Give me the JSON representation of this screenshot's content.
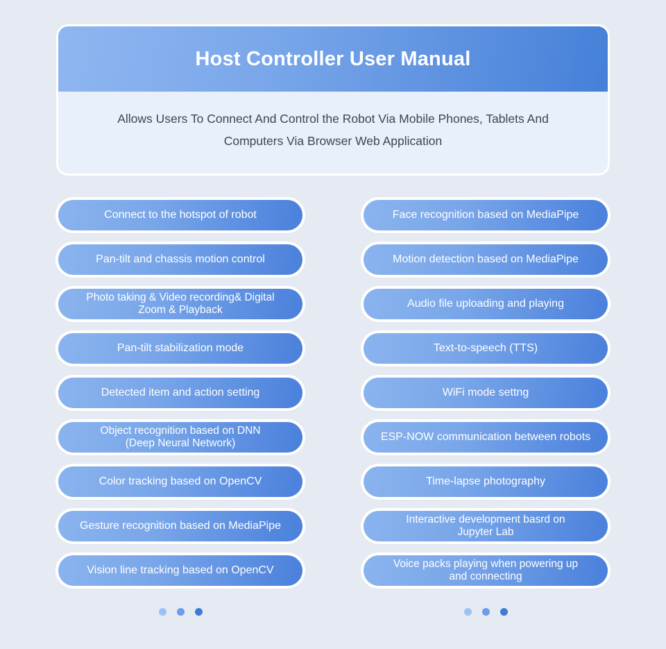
{
  "background_color": "#e6eaf2",
  "header": {
    "title": "Host Controller User Manual",
    "subtitle": "Allows Users To Connect And Control the Robot Via Mobile Phones, Tablets And Computers Via Browser Web Application",
    "banner_gradient_from": "#8fb6f0",
    "banner_gradient_to": "#4580d8",
    "body_background": "#e8f0fb",
    "title_color": "#ffffff",
    "subtitle_color": "#3d4652"
  },
  "pill_style": {
    "gradient_from": "#8ab4ee",
    "gradient_to": "#4a80dc",
    "text_color": "#ffffff",
    "ring_color": "#ffffff"
  },
  "left_column": {
    "items": [
      {
        "label": "Connect to the hotspot of robot",
        "lines": 1
      },
      {
        "label": "Pan-tilt and chassis motion control",
        "lines": 1
      },
      {
        "label": "Photo taking & Video recording& Digital\nZoom & Playback",
        "lines": 2
      },
      {
        "label": "Pan-tilt stabilization mode",
        "lines": 1
      },
      {
        "label": "Detected item and action setting",
        "lines": 1
      },
      {
        "label": "Object recognition based on DNN\n(Deep Neural Network)",
        "lines": 2
      },
      {
        "label": "Color tracking based on OpenCV",
        "lines": 1
      },
      {
        "label": "Gesture recognition based on MediaPipe",
        "lines": 1
      },
      {
        "label": "Vision line tracking based on OpenCV",
        "lines": 1
      }
    ]
  },
  "right_column": {
    "items": [
      {
        "label": "Face recognition based on MediaPipe",
        "lines": 1
      },
      {
        "label": "Motion detection based on MediaPipe",
        "lines": 1
      },
      {
        "label": "Audio file uploading and playing",
        "lines": 1
      },
      {
        "label": "Text-to-speech (TTS)",
        "lines": 1
      },
      {
        "label": "WiFi mode settng",
        "lines": 1
      },
      {
        "label": "ESP-NOW communication between robots",
        "lines": 1
      },
      {
        "label": "Time-lapse photography",
        "lines": 1
      },
      {
        "label": "Interactive development basrd on\nJupyter Lab",
        "lines": 2
      },
      {
        "label": "Voice packs playing when powering up\nand connecting",
        "lines": 2
      }
    ]
  },
  "pagination": {
    "left_dots": [
      "#9cc2f5",
      "#6d9ce8",
      "#3f7bd6"
    ],
    "right_dots": [
      "#9cc2f5",
      "#6d9ce8",
      "#3f7bd6"
    ]
  }
}
